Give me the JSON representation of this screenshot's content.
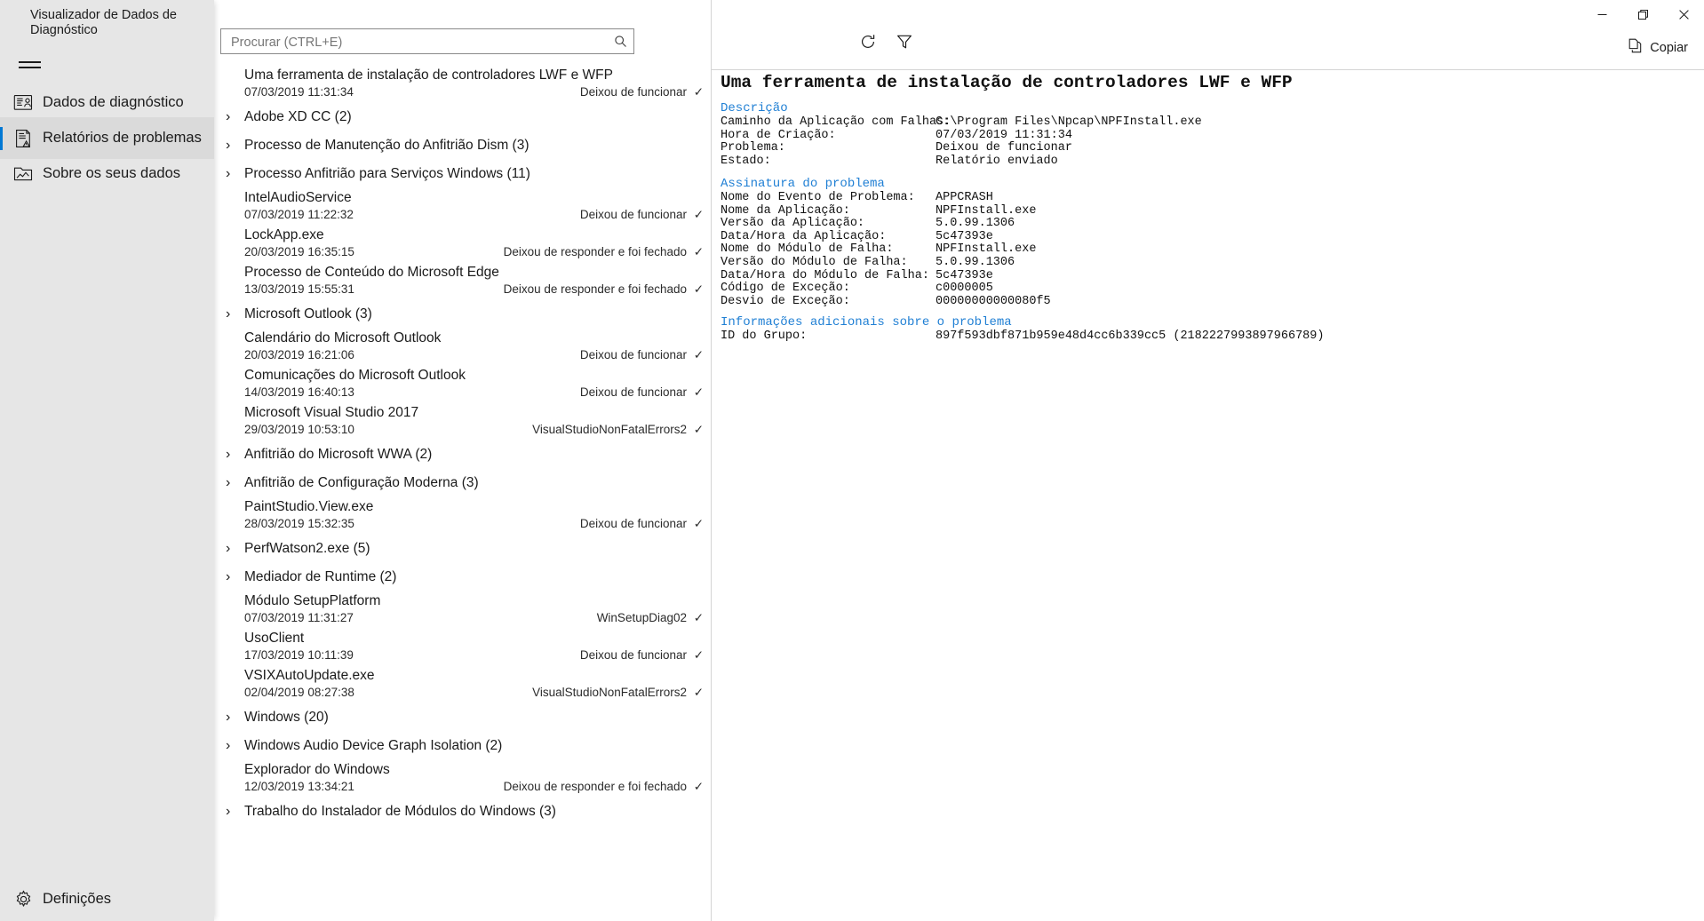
{
  "app": {
    "title": "Visualizador de Dados de Diagnóstico",
    "menu_icon": "hamburger-icon"
  },
  "sidebar": {
    "items": [
      {
        "key": "dados-de-diagnostico",
        "label": "Dados de diagnóstico",
        "icon": "diagnostic-data-icon",
        "selected": false
      },
      {
        "key": "relatorios-de-problemas",
        "label": "Relatórios de problemas",
        "icon": "problem-reports-icon",
        "selected": true
      },
      {
        "key": "sobre-os-seus-dados",
        "label": "Sobre os seus dados",
        "icon": "about-your-data-icon",
        "selected": false
      }
    ],
    "settings": {
      "key": "definicoes",
      "label": "Definições",
      "icon": "gear-icon"
    }
  },
  "toolbar": {
    "search": {
      "placeholder": "Procurar (CTRL+E)",
      "value": "",
      "icon": "search-icon"
    },
    "refresh": {
      "label": "Atualizar",
      "icon": "refresh-icon"
    },
    "filter": {
      "label": "Filtrar",
      "icon": "filter-icon"
    }
  },
  "window": {
    "minimize": {
      "icon": "minimize-icon",
      "glyph": "─"
    },
    "maximize": {
      "icon": "maximize-restore-icon",
      "glyph": "❐"
    },
    "close": {
      "icon": "close-icon",
      "glyph": "✕"
    },
    "copy": {
      "label": "Copiar",
      "icon": "copy-icon"
    }
  },
  "list": {
    "rows": [
      {
        "type": "leaf",
        "title": "Uma ferramenta de instalação de controladores LWF e WFP",
        "date": "07/03/2019 11:31:34",
        "status": "Deixou de funcionar",
        "check": "✓",
        "selected": true
      },
      {
        "type": "group",
        "title": "Adobe XD CC (2)",
        "chevron": "›"
      },
      {
        "type": "group",
        "title": "Processo de Manutenção do Anfitrião Dism (3)",
        "chevron": "›"
      },
      {
        "type": "group",
        "title": "Processo Anfitrião para Serviços Windows (11)",
        "chevron": "›"
      },
      {
        "type": "leaf",
        "title": "IntelAudioService",
        "date": "07/03/2019 11:22:32",
        "status": "Deixou de funcionar",
        "check": "✓"
      },
      {
        "type": "leaf",
        "title": "LockApp.exe",
        "date": "20/03/2019 16:35:15",
        "status": "Deixou de responder e foi fechado",
        "check": "✓"
      },
      {
        "type": "leaf",
        "title": "Processo de Conteúdo do Microsoft Edge",
        "date": "13/03/2019 15:55:31",
        "status": "Deixou de responder e foi fechado",
        "check": "✓"
      },
      {
        "type": "group",
        "title": "Microsoft Outlook (3)",
        "chevron": "›"
      },
      {
        "type": "leaf",
        "title": "Calendário do Microsoft Outlook",
        "date": "20/03/2019 16:21:06",
        "status": "Deixou de funcionar",
        "check": "✓"
      },
      {
        "type": "leaf",
        "title": "Comunicações do Microsoft Outlook",
        "date": "14/03/2019 16:40:13",
        "status": "Deixou de funcionar",
        "check": "✓"
      },
      {
        "type": "leaf",
        "title": "Microsoft Visual Studio 2017",
        "date": "29/03/2019 10:53:10",
        "status": "VisualStudioNonFatalErrors2",
        "check": "✓"
      },
      {
        "type": "group",
        "title": "Anfitrião do Microsoft WWA (2)",
        "chevron": "›"
      },
      {
        "type": "group",
        "title": "Anfitrião de Configuração Moderna (3)",
        "chevron": "›"
      },
      {
        "type": "leaf",
        "title": "PaintStudio.View.exe",
        "date": "28/03/2019 15:32:35",
        "status": "Deixou de funcionar",
        "check": "✓"
      },
      {
        "type": "group",
        "title": "PerfWatson2.exe (5)",
        "chevron": "›"
      },
      {
        "type": "group",
        "title": "Mediador de Runtime (2)",
        "chevron": "›"
      },
      {
        "type": "leaf",
        "title": "Módulo SetupPlatform",
        "date": "07/03/2019 11:31:27",
        "status": "WinSetupDiag02",
        "check": "✓"
      },
      {
        "type": "leaf",
        "title": "UsoClient",
        "date": "17/03/2019 10:11:39",
        "status": "Deixou de funcionar",
        "check": "✓"
      },
      {
        "type": "leaf",
        "title": "VSIXAutoUpdate.exe",
        "date": "02/04/2019 08:27:38",
        "status": "VisualStudioNonFatalErrors2",
        "check": "✓"
      },
      {
        "type": "group",
        "title": "Windows (20)",
        "chevron": "›"
      },
      {
        "type": "group",
        "title": "Windows Audio Device Graph Isolation (2)",
        "chevron": "›"
      },
      {
        "type": "leaf",
        "title": "Explorador do Windows",
        "date": "12/03/2019 13:34:21",
        "status": "Deixou de responder e foi fechado",
        "check": "✓"
      },
      {
        "type": "group",
        "title": "Trabalho do Instalador de Módulos do Windows (3)",
        "chevron": "›"
      }
    ]
  },
  "detail": {
    "title": "Uma ferramenta de instalação de controladores LWF e WFP",
    "sections": [
      {
        "heading": "Descrição",
        "rows": [
          {
            "key": "Caminho da Aplicação com Falhas:",
            "value": "C:\\Program Files\\Npcap\\NPFInstall.exe"
          },
          {
            "key": "Hora de Criação:",
            "value": "07/03/2019 11:31:34"
          },
          {
            "key": "Problema:",
            "value": "Deixou de funcionar"
          },
          {
            "key": "Estado:",
            "value": "Relatório enviado"
          }
        ]
      },
      {
        "heading": "Assinatura do problema",
        "rows": [
          {
            "key": "Nome do Evento de Problema:",
            "value": "APPCRASH"
          },
          {
            "key": "Nome da Aplicação:",
            "value": "NPFInstall.exe"
          },
          {
            "key": "Versão da Aplicação:",
            "value": "5.0.99.1306"
          },
          {
            "key": "Data/Hora da Aplicação:",
            "value": "5c47393e"
          },
          {
            "key": "Nome do Módulo de Falha:",
            "value": "NPFInstall.exe"
          },
          {
            "key": "Versão do Módulo de Falha:",
            "value": "5.0.99.1306"
          },
          {
            "key": "Data/Hora do Módulo de Falha:",
            "value": "5c47393e"
          },
          {
            "key": "Código de Exceção:",
            "value": "c0000005"
          },
          {
            "key": "Desvio de Exceção:",
            "value": "00000000000080f5"
          }
        ]
      },
      {
        "heading": "Informações adicionais sobre o problema",
        "rows": [
          {
            "key": "ID do Grupo:",
            "value": "897f593dbf871b959e48d4cc6b339cc5 (2182227993897966789)"
          }
        ]
      }
    ]
  },
  "colors": {
    "accent": "#0078d4",
    "section_heading": "#1f7fd4",
    "sidebar_bg": "#e6e6e6",
    "close_hover": "#e81123"
  }
}
